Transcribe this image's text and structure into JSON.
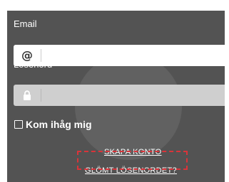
{
  "form": {
    "email_label": "Email",
    "email_value": "",
    "email_icon": "at-icon",
    "password_label": "Lösenord",
    "password_value": "",
    "password_icon": "lock-icon",
    "remember_label": "Kom ihåg mig",
    "remember_checked": false
  },
  "links": {
    "create_account": "SKAPA KONTO",
    "forgot_password": "GLÖMT LÖSENORDET?"
  },
  "colors": {
    "panel_bg": "#535353",
    "highlight": "#d9343a"
  }
}
